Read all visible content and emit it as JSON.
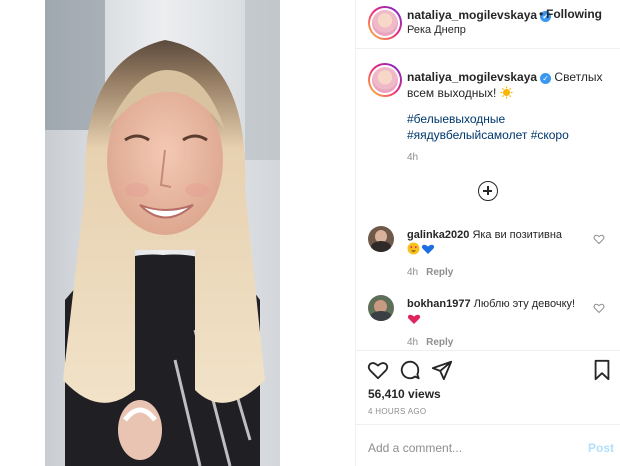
{
  "header": {
    "username": "nataliya_mogilevskaya",
    "separator": "•",
    "follow_label": "Following",
    "location": "Река Днепр"
  },
  "caption": {
    "username": "nataliya_mogilevskaya",
    "text": "Светлых всем выходных!",
    "emoji": "sun-emoji",
    "hashtags_line1": "#белыевыходные",
    "hashtags_line2": "#яядувбелыйсамолет #скоро",
    "time": "4h"
  },
  "load_more_icon": "plus-circle-icon",
  "comments": [
    {
      "username": "galinka2020",
      "text": "Яка ви позитивна",
      "emoji": "heart-eyes-emoji blue-heart-emoji",
      "time": "4h",
      "reply_label": "Reply"
    },
    {
      "username": "bokhan1977",
      "text": "Люблю эту девочку!",
      "emoji": "red-heart-emoji",
      "time": "4h",
      "reply_label": "Reply"
    }
  ],
  "actions": {
    "icons": [
      "heart-icon",
      "comment-icon",
      "share-icon",
      "bookmark-icon"
    ]
  },
  "views": "56,410 views",
  "posted_ago": "4 HOURS AGO",
  "comment_box": {
    "placeholder": "Add a comment...",
    "post_label": "Post"
  },
  "colors": {
    "link": "#00376b",
    "verified": "#3897f0",
    "muted": "#8e8e8e",
    "post_disabled": "#b2dffc"
  }
}
